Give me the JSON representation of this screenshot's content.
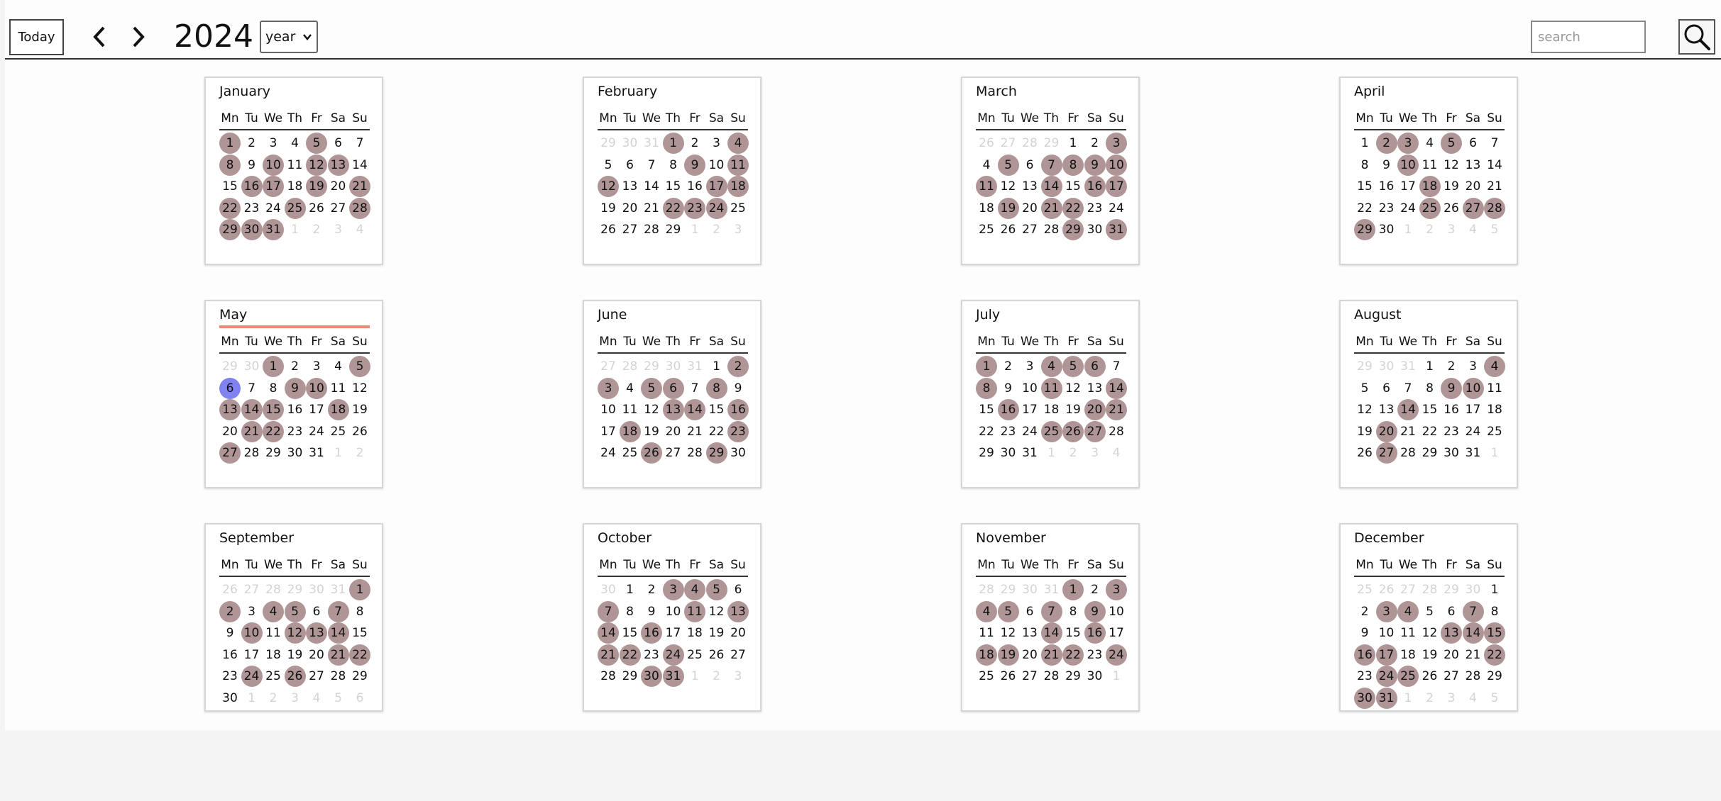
{
  "toolbar": {
    "today_label": "Today",
    "year": "2024",
    "view_select": {
      "value": "year"
    },
    "search_placeholder": "search",
    "search_value": ""
  },
  "day_headers": [
    "Mn",
    "Tu",
    "We",
    "Th",
    "Fr",
    "Sa",
    "Su"
  ],
  "current_month_index": 4,
  "today": {
    "month_index": 4,
    "day": 6
  },
  "colors": {
    "event_marker": "#b09597",
    "today_marker": "#7f82f0",
    "current_month_bar": "#ef8a7a"
  },
  "months": [
    {
      "name": "January",
      "lead": [],
      "last_day": 31,
      "trail": [
        1,
        2,
        3,
        4
      ],
      "events": [
        1,
        5,
        8,
        10,
        12,
        13,
        16,
        17,
        19,
        21,
        22,
        25,
        28,
        29,
        30,
        31
      ]
    },
    {
      "name": "February",
      "lead": [
        29,
        30,
        31
      ],
      "last_day": 29,
      "trail": [
        1,
        2,
        3
      ],
      "events": [
        1,
        4,
        9,
        11,
        12,
        17,
        18,
        22,
        23,
        24
      ]
    },
    {
      "name": "March",
      "lead": [
        26,
        27,
        28,
        29
      ],
      "last_day": 31,
      "trail": [],
      "events": [
        3,
        5,
        7,
        8,
        9,
        10,
        11,
        14,
        16,
        17,
        19,
        21,
        22,
        29,
        31
      ]
    },
    {
      "name": "April",
      "lead": [],
      "last_day": 30,
      "trail": [
        1,
        2,
        3,
        4,
        5
      ],
      "events": [
        2,
        3,
        5,
        10,
        18,
        25,
        27,
        28,
        29
      ]
    },
    {
      "name": "May",
      "lead": [
        29,
        30
      ],
      "last_day": 31,
      "trail": [
        1,
        2
      ],
      "events": [
        1,
        5,
        9,
        10,
        13,
        14,
        15,
        18,
        21,
        22,
        27
      ]
    },
    {
      "name": "June",
      "lead": [
        27,
        28,
        29,
        30,
        31
      ],
      "last_day": 30,
      "trail": [],
      "events": [
        2,
        3,
        5,
        6,
        8,
        13,
        14,
        16,
        18,
        23,
        26,
        29
      ]
    },
    {
      "name": "July",
      "lead": [],
      "last_day": 31,
      "trail": [
        1,
        2,
        3,
        4
      ],
      "events": [
        1,
        4,
        5,
        6,
        8,
        11,
        14,
        16,
        20,
        21,
        25,
        26,
        27
      ]
    },
    {
      "name": "August",
      "lead": [
        29,
        30,
        31
      ],
      "last_day": 31,
      "trail": [
        1
      ],
      "events": [
        4,
        9,
        10,
        14,
        20,
        27
      ]
    },
    {
      "name": "September",
      "lead": [
        26,
        27,
        28,
        29,
        30,
        31
      ],
      "last_day": 30,
      "trail": [
        1,
        2,
        3,
        4,
        5,
        6
      ],
      "events": [
        1,
        2,
        4,
        5,
        7,
        10,
        12,
        13,
        14,
        21,
        22,
        24,
        26
      ]
    },
    {
      "name": "October",
      "lead": [
        30
      ],
      "last_day": 31,
      "trail": [
        1,
        2,
        3
      ],
      "events": [
        3,
        4,
        5,
        7,
        11,
        13,
        14,
        16,
        21,
        22,
        24,
        30,
        31
      ]
    },
    {
      "name": "November",
      "lead": [
        28,
        29,
        30,
        31
      ],
      "last_day": 30,
      "trail": [
        1
      ],
      "events": [
        1,
        3,
        4,
        5,
        7,
        9,
        14,
        16,
        18,
        19,
        21,
        22,
        24
      ]
    },
    {
      "name": "December",
      "lead": [
        25,
        26,
        27,
        28,
        29,
        30
      ],
      "last_day": 31,
      "trail": [
        1,
        2,
        3,
        4,
        5
      ],
      "events": [
        3,
        4,
        7,
        13,
        14,
        15,
        16,
        17,
        22,
        24,
        25,
        30,
        31
      ]
    }
  ]
}
